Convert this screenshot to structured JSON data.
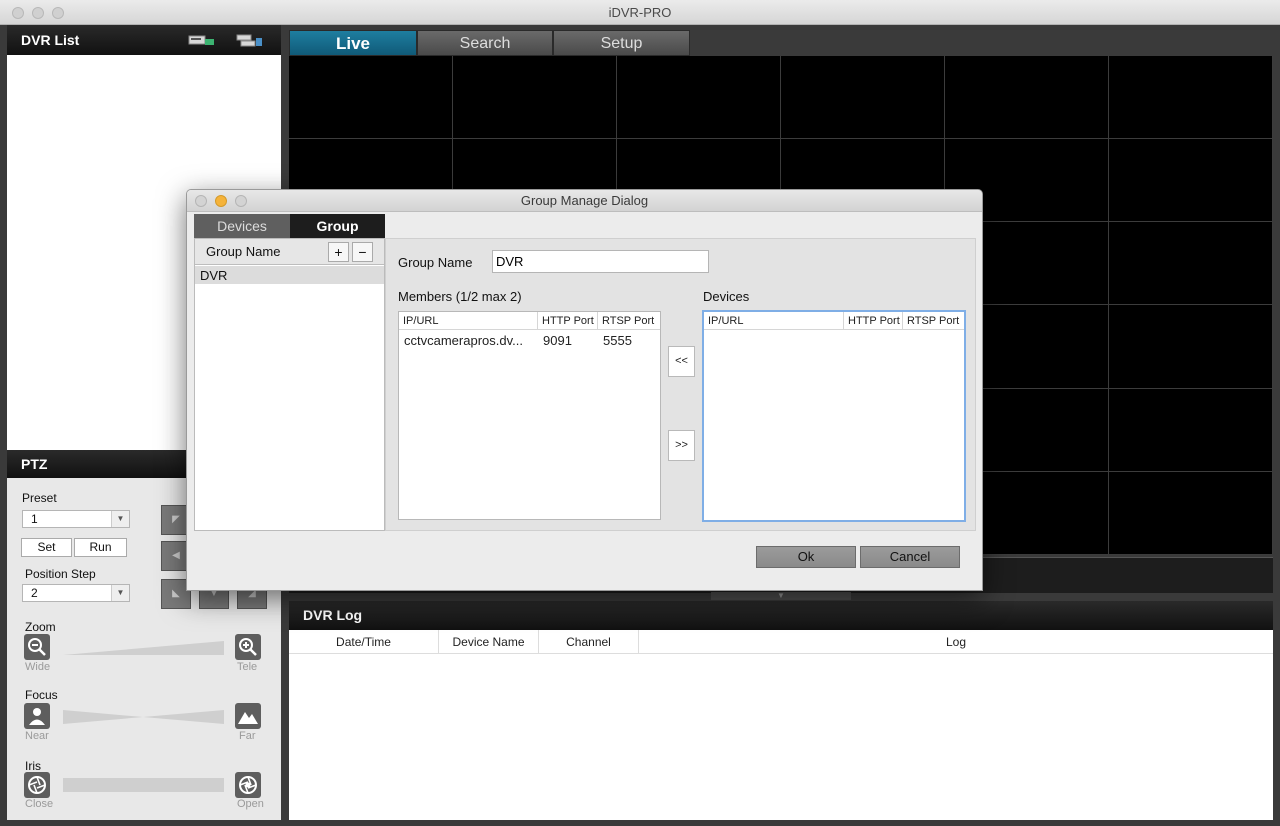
{
  "window": {
    "title": "iDVR-PRO"
  },
  "dvr_list": {
    "header": "DVR List",
    "icons": [
      "add-dvr-icon",
      "group-dvr-icon"
    ]
  },
  "tabs": [
    {
      "label": "Live",
      "active": true
    },
    {
      "label": "Search",
      "active": false
    },
    {
      "label": "Setup",
      "active": false
    }
  ],
  "ptz": {
    "header": "PTZ",
    "preset_label": "Preset",
    "preset_value": "1",
    "set_label": "Set",
    "run_label": "Run",
    "position_step_label": "Position Step",
    "position_step_value": "2",
    "zoom_label": "Zoom",
    "zoom_wide": "Wide",
    "zoom_tele": "Tele",
    "focus_label": "Focus",
    "focus_near": "Near",
    "focus_far": "Far",
    "iris_label": "Iris",
    "iris_close": "Close",
    "iris_open": "Open"
  },
  "dvr_log": {
    "header": "DVR Log",
    "columns": [
      "Date/Time",
      "Device Name",
      "Channel",
      "Log"
    ]
  },
  "dialog": {
    "title": "Group Manage Dialog",
    "tabs": [
      {
        "label": "Devices",
        "active": false
      },
      {
        "label": "Group",
        "active": true
      }
    ],
    "group_name_header": "Group Name",
    "add_label": "+",
    "remove_label": "−",
    "groups": [
      "DVR"
    ],
    "group_name_field_label": "Group Name",
    "group_name_value": "DVR",
    "members_label": "Members (1/2 max 2)",
    "devices_label": "Devices",
    "columns": [
      "IP/URL",
      "HTTP Port",
      "RTSP Port"
    ],
    "members": [
      {
        "ip": "cctvcamerapros.dv...",
        "http": "9091",
        "rtsp": "5555"
      }
    ],
    "move_left_label": "<<",
    "move_right_label": ">>",
    "ok_label": "Ok",
    "cancel_label": "Cancel"
  }
}
